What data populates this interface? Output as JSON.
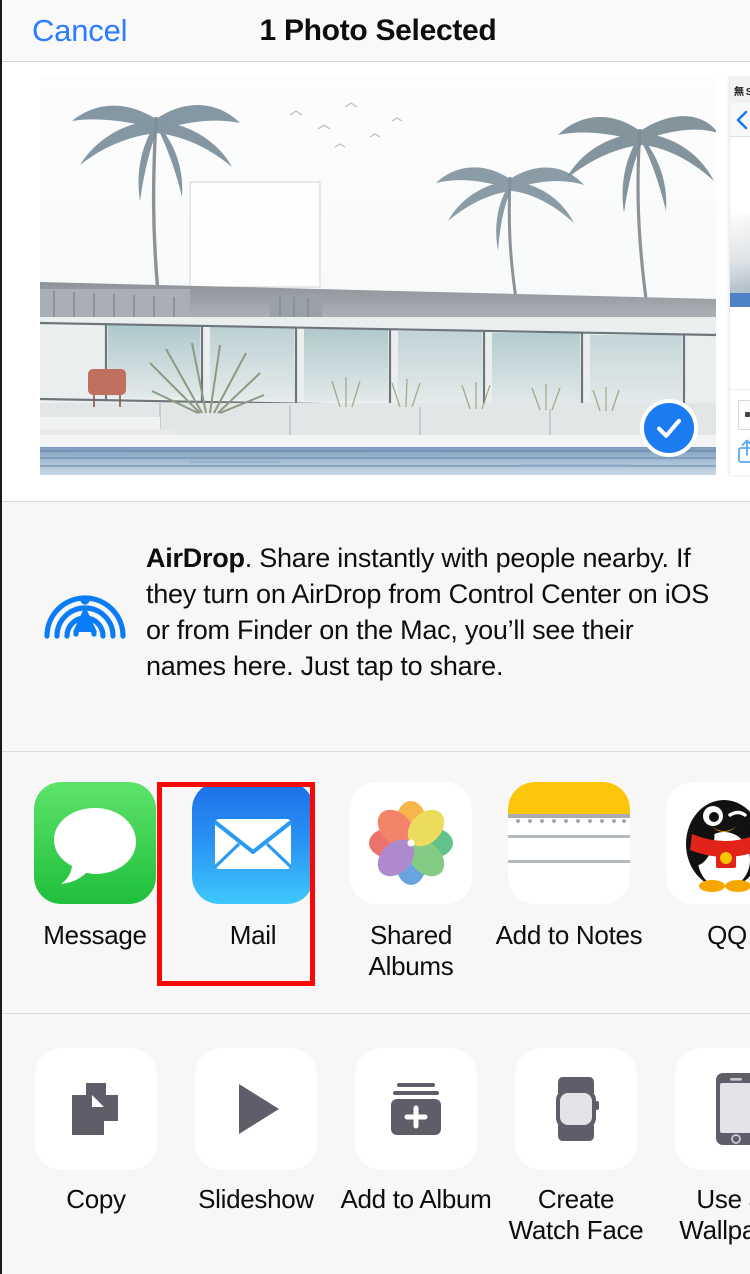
{
  "header": {
    "cancel_label": "Cancel",
    "title": "1 Photo Selected"
  },
  "preview": {
    "selected_badge_icon": "checkmark-icon",
    "photo_alt": "sketch-style photo of modern beach house with palm trees and pool",
    "peek_card": {
      "carrier_text": "無 S",
      "back_icon": "chevron-left-icon",
      "share_icon": "share-icon"
    }
  },
  "airdrop": {
    "icon": "airdrop-icon",
    "title": "AirDrop",
    "body": ". Share instantly with people nearby. If they turn on AirDrop from Control Center on iOS or from Finder on the Mac, you’ll see their names here. Just tap to share."
  },
  "apps": {
    "highlight_color": "#fb0707",
    "highlighted_index": 1,
    "items": [
      {
        "label": "Message",
        "icon": "messages-app-icon"
      },
      {
        "label": "Mail",
        "icon": "mail-app-icon"
      },
      {
        "label": "Shared\nAlbums",
        "icon": "photos-app-icon"
      },
      {
        "label": "Add to Notes",
        "icon": "notes-app-icon"
      },
      {
        "label": "QQ",
        "icon": "qq-app-icon"
      }
    ]
  },
  "actions": {
    "items": [
      {
        "label": "Copy",
        "icon": "copy-icon"
      },
      {
        "label": "Slideshow",
        "icon": "play-icon"
      },
      {
        "label": "Add to Album",
        "icon": "add-to-album-icon"
      },
      {
        "label": "Create\nWatch Face",
        "icon": "apple-watch-icon"
      },
      {
        "label": "Use as\nWallpaper",
        "icon": "iphone-icon"
      }
    ]
  },
  "colors": {
    "accent_blue": "#2b7cff",
    "badge_blue": "#1a7cf0",
    "airdrop_blue": "#0a7cf5",
    "sheet_bg": "#f7f7f7",
    "glyph_gray": "#5e5e6b"
  }
}
